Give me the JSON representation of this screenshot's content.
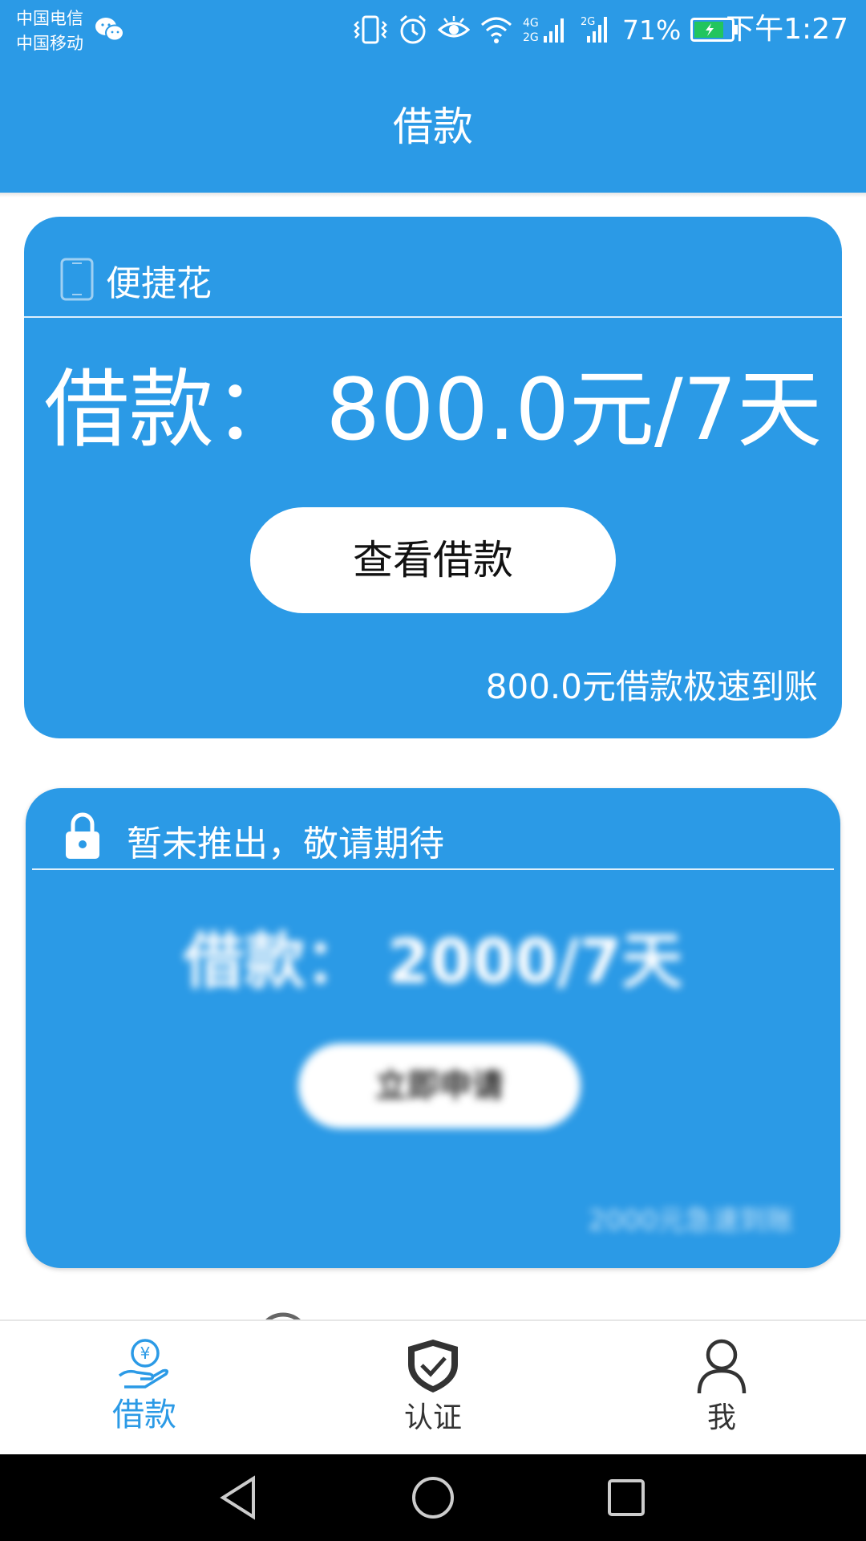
{
  "status_bar": {
    "carrier1": "中国电信",
    "carrier2": "中国移动",
    "battery_percent": "71%",
    "time": "下午1:27",
    "icons": [
      "wechat-icon",
      "vibrate-icon",
      "alarm-icon",
      "eye-icon",
      "wifi-icon",
      "signal-4g-icon",
      "signal-2g-icon",
      "battery-icon"
    ]
  },
  "header": {
    "title": "借款"
  },
  "card1": {
    "product_name": "便捷花",
    "amount_text": "借款：  800.0元/7天",
    "button_label": "查看借款",
    "footnote": "800.0元借款极速到账"
  },
  "card2": {
    "locked_text": "暂未推出，敬请期待",
    "amount_text": "借款：  2000/7天",
    "button_label": "立即申请",
    "footnote": "2000元急速到账"
  },
  "tabs": [
    {
      "label": "借款",
      "icon": "loan-hand-yen-icon",
      "active": true
    },
    {
      "label": "认证",
      "icon": "shield-check-icon",
      "active": false
    },
    {
      "label": "我",
      "icon": "person-icon",
      "active": false
    }
  ],
  "colors": {
    "primary": "#2b9ae6",
    "text_dark": "#333333",
    "white": "#ffffff"
  }
}
